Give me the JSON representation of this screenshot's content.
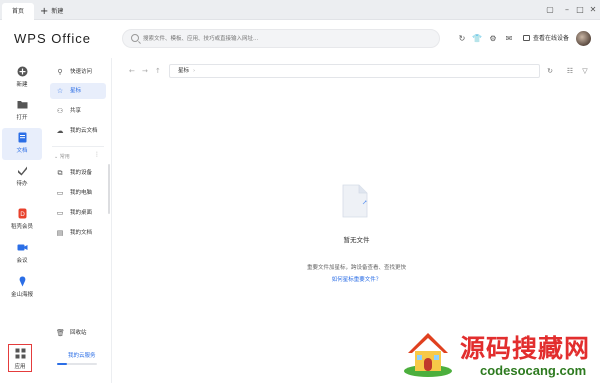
{
  "titlebar": {
    "home_tab": "首页",
    "new_tab": "新建"
  },
  "header": {
    "logo": "WPS Office",
    "search_placeholder": "搜索文件、模板、应用、技巧或直接输入网址...",
    "devices_label": "查看在线设备"
  },
  "leftnav": {
    "items": [
      {
        "label": "新建",
        "icon": "plus-circle-icon"
      },
      {
        "label": "打开",
        "icon": "folder-icon"
      },
      {
        "label": "文档",
        "icon": "document-icon",
        "active": true
      },
      {
        "label": "待办",
        "icon": "checkmark-icon"
      },
      {
        "label": "稻壳会员",
        "icon": "docer-icon"
      },
      {
        "label": "会议",
        "icon": "video-icon"
      },
      {
        "label": "金山海报",
        "icon": "poster-icon"
      },
      {
        "label": "应用",
        "icon": "apps-grid-icon"
      }
    ]
  },
  "sidebar": {
    "items": [
      {
        "label": "快速访问",
        "icon": "pin-icon"
      },
      {
        "label": "星标",
        "icon": "star-icon",
        "active": true
      },
      {
        "label": "共享",
        "icon": "share-icon"
      },
      {
        "label": "我的云文档",
        "icon": "cloud-icon"
      }
    ],
    "section": "常用",
    "common_items": [
      {
        "label": "我的设备",
        "icon": "device-icon"
      },
      {
        "label": "我的电脑",
        "icon": "computer-icon"
      },
      {
        "label": "我的桌面",
        "icon": "desktop-icon"
      },
      {
        "label": "我的文档",
        "icon": "documents-icon"
      }
    ],
    "recycle": "回收站",
    "cloud_service": "我的云服务",
    "storage_used": 0.25
  },
  "main": {
    "path": "星标",
    "empty_title": "暂无文件",
    "empty_desc": "重要文件加星标，跨设备查看、查找更快",
    "empty_link": "如何星标重要文件？"
  },
  "watermark": {
    "text": "源码搜藏网",
    "url": "codesocang.com"
  },
  "colors": {
    "accent": "#2b6ee6",
    "active_bg": "#e8eefb",
    "highlight_box": "#e43c3c"
  }
}
